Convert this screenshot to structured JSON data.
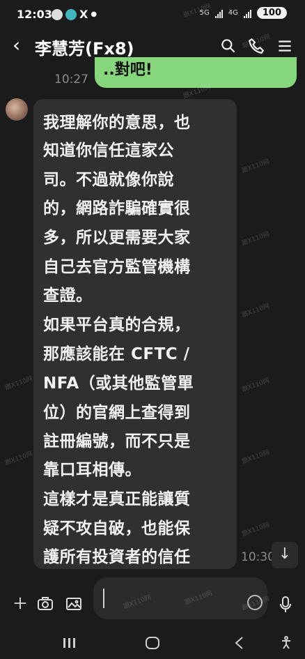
{
  "status_bar": {
    "time": "12:03",
    "network_5g": "5G",
    "network_4g": "4G",
    "battery": "100"
  },
  "header": {
    "title": "李慧芳(Fx8)"
  },
  "previous_message": {
    "time": "10:27",
    "text": "..對吧!"
  },
  "message": {
    "lines": [
      "我理解你的意思，也",
      "知道你信任這家公",
      "司。不過就像你說",
      "的，網路詐騙確實很",
      "多，所以更需要大家",
      "自己去官方監管機構",
      "查證。",
      "如果平台真的合規，",
      "那應該能在 CFTC /",
      "NFA（或其他監管單",
      "位）的官網上查得到",
      "註冊編號，而不只是",
      "靠口耳相傳。",
      "這樣才是真正能讓質",
      "疑不攻自破，也能保",
      "護所有投資者的信任"
    ],
    "time": "10:30"
  },
  "watermark": {
    "text": "跟X110网"
  }
}
